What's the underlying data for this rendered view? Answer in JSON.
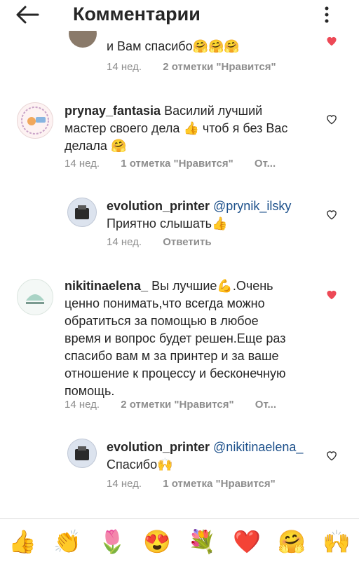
{
  "header": {
    "title": "Комментарии",
    "back_icon": "arrow-left-icon",
    "more_icon": "vertical-dots-icon"
  },
  "comments": [
    {
      "text": "и Вам спасибо🤗🤗🤗",
      "time": "14 нед.",
      "likes": "2 отметки \"Нравится\""
    },
    {
      "user": "prynay_fantasia",
      "text": "Василий лучший мастер своего дела 👍 чтоб я без Вас делала 🤗",
      "time": "14 нед.",
      "likes": "1 отметка \"Нравится\"",
      "reply": "От..."
    },
    {
      "user": "evolution_printer",
      "mention": "@prynik_ilsky",
      "text": "Приятно слышать👍",
      "time": "14 нед.",
      "reply": "Ответить"
    },
    {
      "user": "nikitinaelena_",
      "text": "Вы лучшие💪.Очень ценно понимать,что всегда можно обратиться за помощью в любое время и вопрос будет решен.Еще раз спасибо вам м за принтер и за ваше отношение к процессу и бесконечную помощь.",
      "time": "14 нед.",
      "likes": "2 отметки \"Нравится\"",
      "reply": "От...",
      "liked": true
    },
    {
      "user": "evolution_printer",
      "mention": "@nikitinaelena_",
      "text": "Спасибо🙌",
      "time": "14 нед.",
      "likes": "1 отметка \"Нравится\""
    }
  ],
  "emoji_bar": [
    "👍",
    "👏",
    "🌷",
    "😍",
    "💐",
    "❤️",
    "🤗",
    "🙌"
  ],
  "colors": {
    "text": "#262626",
    "muted": "#8e8e8e",
    "mention": "#1b4f8a",
    "liked_heart": "#ed4956"
  }
}
